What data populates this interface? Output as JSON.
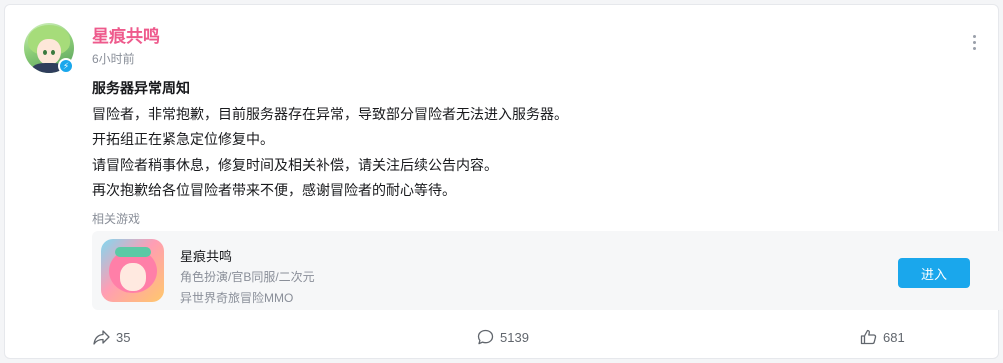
{
  "post": {
    "author": "星痕共鸣",
    "time": "6小时前",
    "title": "服务器异常周知",
    "lines": [
      "冒险者，非常抱歉，目前服务器存在异常，导致部分冒险者无法进入服务器。",
      "开拓组正在紧急定位修复中。",
      "请冒险者稍事休息，修复时间及相关补偿，请关注后续公告内容。",
      "再次抱歉给各位冒险者带来不便，感谢冒险者的耐心等待。"
    ]
  },
  "related": {
    "label": "相关游戏",
    "game": {
      "name": "星痕共鸣",
      "tags": "角色扮演/官B同服/二次元",
      "desc": "异世界奇旅冒险MMO",
      "button_label": "进入"
    }
  },
  "stats": {
    "shares": "35",
    "comments": "5139",
    "likes": "681"
  },
  "icons": {
    "badge": "lightning-badge-icon",
    "more": "more-vertical-icon",
    "share": "share-arrow-icon",
    "comment": "comment-bubble-icon",
    "like": "thumbs-up-icon"
  },
  "colors": {
    "author": "#ee5a8c",
    "accent": "#1aa7ec",
    "muted": "#8a8f99"
  }
}
